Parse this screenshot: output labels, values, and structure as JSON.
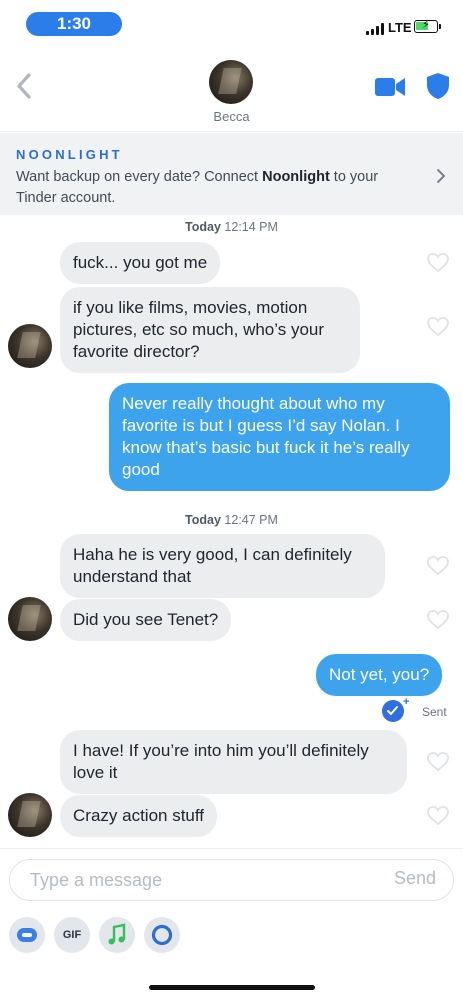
{
  "status_bar": {
    "time": "1:30",
    "network": "LTE",
    "battery_charging": true
  },
  "header": {
    "contact_name": "Becca"
  },
  "banner": {
    "brand": "NOONLIGHT",
    "text_before": "Want backup on every date? Connect ",
    "text_bold": "Noonlight",
    "text_after": " to your Tinder account."
  },
  "conversation": {
    "timestamps": [
      {
        "day": "Today",
        "time": "12:14 PM"
      },
      {
        "day": "Today",
        "time": "12:47 PM"
      }
    ],
    "messages": [
      {
        "from": "them",
        "text": "fuck... you got me"
      },
      {
        "from": "them",
        "text": "if you like films, movies, motion pictures, etc so much, who’s your favorite director?"
      },
      {
        "from": "me",
        "text": "Never really thought about who my favorite is but I guess I’d say Nolan. I know that’s basic but fuck it he’s really good"
      },
      {
        "from": "them",
        "text": "Haha he is very good, I can definitely understand that"
      },
      {
        "from": "them",
        "text": "Did you see Tenet?"
      },
      {
        "from": "me",
        "text": "Not yet, you?"
      },
      {
        "from": "them",
        "text": "I have! If you’re into him you’ll definitely love it"
      },
      {
        "from": "them",
        "text": "Crazy action stuff"
      }
    ],
    "sent_status": "Sent"
  },
  "composer": {
    "placeholder": "Type a message",
    "send_label": "Send",
    "gif_label": "GIF"
  },
  "colors": {
    "outgoing_bubble": "#3ca3ec",
    "incoming_bubble": "#ecedef",
    "accent": "#2b7de9",
    "brand": "#2c6ecb"
  }
}
